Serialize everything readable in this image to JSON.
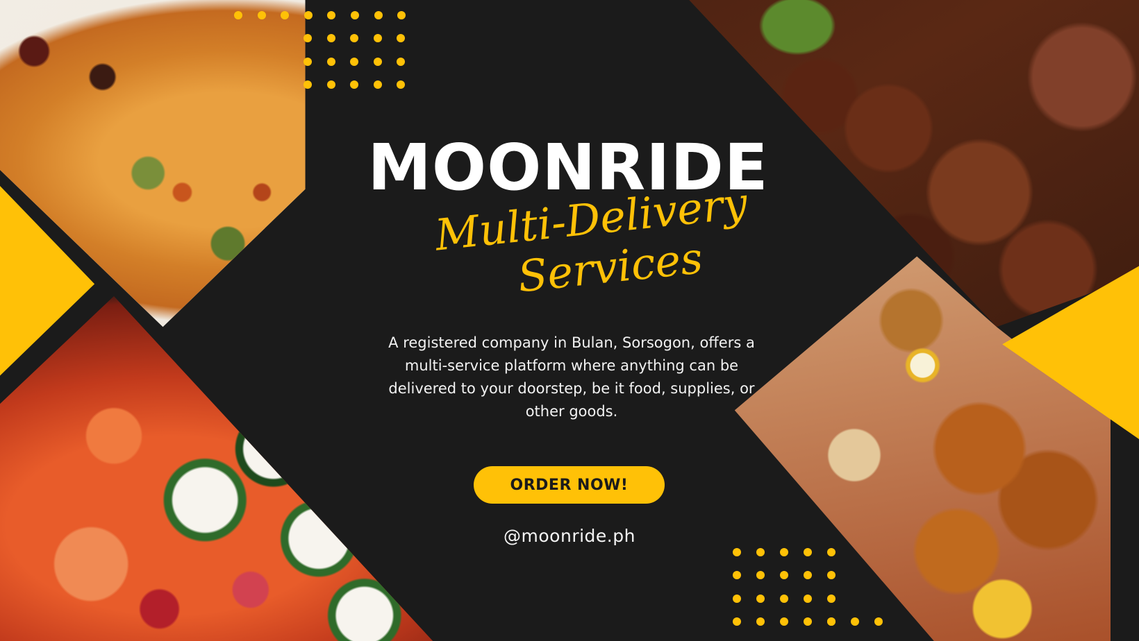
{
  "brand": {
    "title": "MOONRIDE",
    "tagline_line1": "Multi-Delivery",
    "tagline_line2": "Services"
  },
  "description": "A registered company in Bulan, Sorsogon, offers a multi-service platform where anything can be delivered to your doorstep, be it food, supplies, or other goods.",
  "cta": {
    "label": "ORDER NOW!"
  },
  "social": {
    "handle": "@moonride.ph"
  },
  "colors": {
    "background": "#1b1b1b",
    "accent": "#ffc107",
    "text": "#ffffff"
  },
  "images": {
    "top_left": "pizza",
    "bottom_left": "sushi",
    "top_right": "braised-meat",
    "bottom_right": "fried-chicken-meal"
  }
}
